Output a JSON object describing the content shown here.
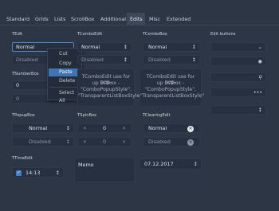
{
  "tabs": [
    "Standard",
    "Grids",
    "Lists",
    "ScrollBox",
    "Additional",
    "Edits",
    "Misc",
    "Extended"
  ],
  "active_tab": "Edits",
  "tedit": {
    "label": "TEdit",
    "value": "Normal",
    "disabled_value": "Disabled"
  },
  "context_menu": {
    "items": [
      "Cut",
      "Copy",
      "Paste",
      "Delete",
      "Select All"
    ],
    "selected": "Paste"
  },
  "tnumberbox": {
    "label": "TNumberBox",
    "value1": "0",
    "value2": "0"
  },
  "tcombo_edit": {
    "label": "TComboEdit",
    "value": "Normal",
    "disabled_value": "Disabled",
    "note": [
      "TComboEdit use for pop-",
      "up listbox -",
      "\"ComboPopupStyle\",",
      "\"TransparentListBoxStyle\""
    ]
  },
  "tcombo_box": {
    "label": "TComboBox",
    "value": "Normal",
    "disabled_value": "Disabled",
    "note": [
      "TComboEdit use for pop-",
      "up listbox -",
      "\"ComboPopupStyle\",",
      "\"TransparentListBoxStyle\""
    ]
  },
  "edit_buttons": {
    "label": "Edit buttons",
    "icons": [
      "chevron-down-icon",
      "eye-icon",
      "search-icon",
      "ellipsis-icon",
      "updown-icon"
    ]
  },
  "tpopupbox": {
    "label": "TPopupBox",
    "value": "Normal",
    "disabled_value": "Disabled"
  },
  "tspinbox": {
    "label": "TSpinBox",
    "value1": "0",
    "value2": "0"
  },
  "tclearingedit": {
    "label": "TClearingEdit",
    "value": "Normal",
    "disabled_value": "Disabled"
  },
  "ttimeedit": {
    "label": "TTimeEdit",
    "value": "14:13"
  },
  "memo": {
    "label": "Memo"
  },
  "tdateedit": {
    "value": "07.12.2017"
  },
  "colors": {
    "background": "#2d3645",
    "field": "#273040",
    "accent": "#3f74b6"
  }
}
